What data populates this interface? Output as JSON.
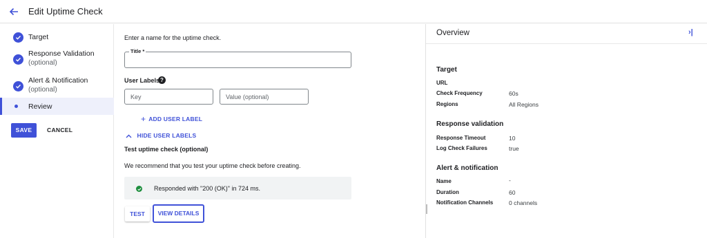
{
  "header": {
    "title": "Edit Uptime Check"
  },
  "steps": [
    {
      "label": "Target",
      "sub": ""
    },
    {
      "label": "Response Validation",
      "sub": "(optional)"
    },
    {
      "label": "Alert & Notification",
      "sub": "(optional)"
    },
    {
      "label": "Review",
      "sub": ""
    }
  ],
  "actions": {
    "save": "SAVE",
    "cancel": "CANCEL"
  },
  "form": {
    "intro": "Enter a name for the uptime check.",
    "title_label": "Title *",
    "title_value": "",
    "user_labels_heading": "User Labels",
    "help_glyph": "?",
    "key_placeholder": "Key",
    "value_placeholder": "Value (optional)",
    "add_label": "ADD USER LABEL",
    "hide_labels": "HIDE USER LABELS",
    "test_heading": "Test uptime check (optional)",
    "test_note": "We recommend that you test your uptime check before creating.",
    "result": "Responded with \"200 (OK)\" in 724 ms.",
    "test_btn": "TEST",
    "details_btn": "VIEW DETAILS"
  },
  "overview": {
    "title": "Overview",
    "collapse_glyph": "›|",
    "sections": {
      "target": {
        "heading": "Target",
        "rows": [
          {
            "k": "URL",
            "v": ""
          },
          {
            "k": "Check Frequency",
            "v": "60s"
          },
          {
            "k": "Regions",
            "v": "All Regions"
          }
        ]
      },
      "response": {
        "heading": "Response validation",
        "rows": [
          {
            "k": "Response Timeout",
            "v": "10"
          },
          {
            "k": "Log Check Failures",
            "v": "true"
          }
        ]
      },
      "alert": {
        "heading": "Alert & notification",
        "rows": [
          {
            "k": "Name",
            "v": "-"
          },
          {
            "k": "Duration",
            "v": "60"
          },
          {
            "k": "Notification Channels",
            "v": "0 channels"
          }
        ]
      }
    }
  },
  "colors": {
    "accent": "#3f51d8",
    "success": "#1e8e3e",
    "selected_bg": "#eef0fb"
  },
  "icons": {
    "back": "arrow-left-icon",
    "check": "check-circle-icon",
    "help": "help-icon",
    "add": "plus-icon",
    "collapse": "chevron-up-icon",
    "success": "success-check-icon",
    "panel": "collapse-panel-icon"
  }
}
